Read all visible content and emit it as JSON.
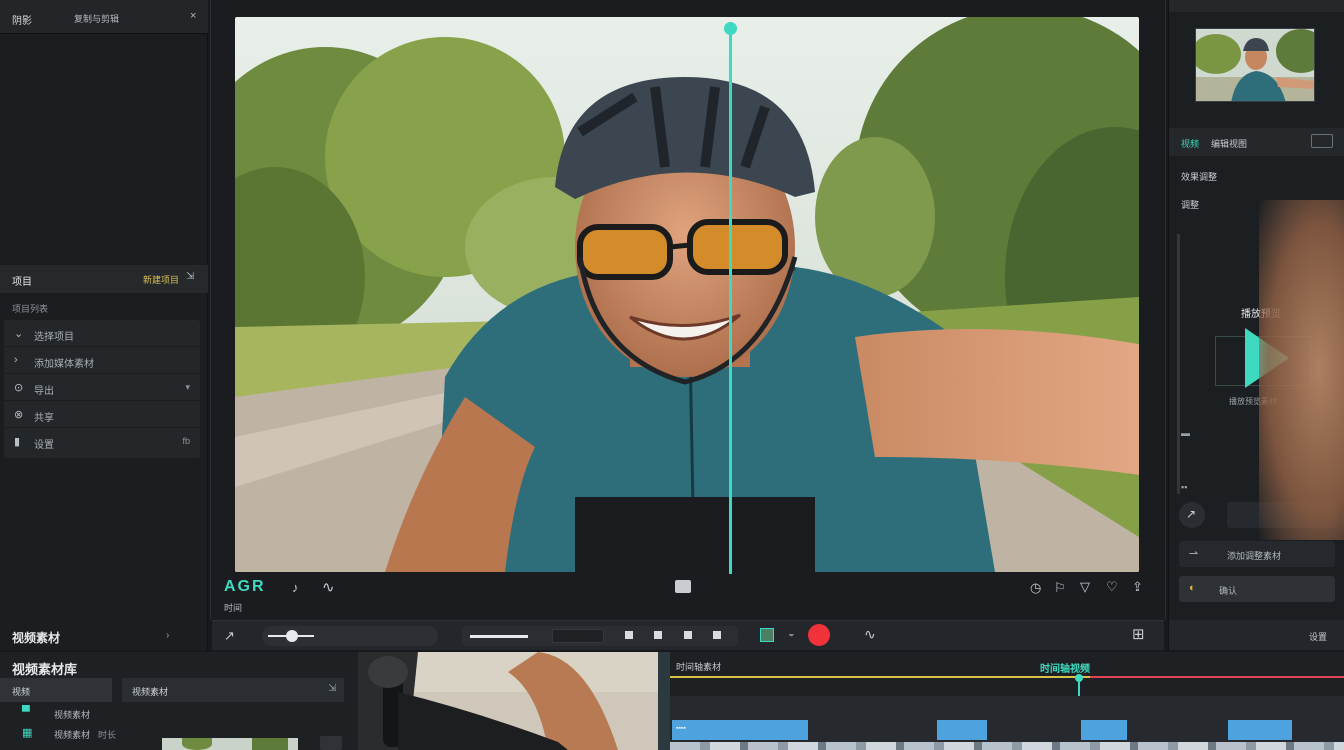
{
  "left": {
    "top_title": "阴影",
    "top_subtitle": "复制与剪辑",
    "section_title": "项目",
    "section_action": "新建项目",
    "subheader": "项目列表",
    "items": [
      {
        "icon": "⌄",
        "label": "选择项目",
        "end": ""
      },
      {
        "icon": "›",
        "label": "添加媒体素材",
        "end": ""
      },
      {
        "icon": "⊙",
        "label": "导出",
        "end": "▾"
      },
      {
        "icon": "⊗",
        "label": "共享",
        "end": ""
      },
      {
        "icon": "▮",
        "label": "设置",
        "end": "fb"
      }
    ],
    "footer_title": "视频素材",
    "footer_action": "›"
  },
  "viewer": {
    "timecode": "AGR",
    "timecode_label": "时间",
    "mode_icons": [
      "♪",
      "∿"
    ]
  },
  "right": {
    "header_tag": "视频",
    "header_title": "编辑视图",
    "label_one": "效果调整",
    "label_two": "调整",
    "play_label": "播放预览",
    "play_caption": "播放预览素材",
    "control_label": "添加调整素材",
    "button_label": "确认",
    "footer_label": "设置"
  },
  "bottom": {
    "title": "视频素材库",
    "tab_one": "视频",
    "tab_two": "视频素材",
    "row_one": "视频素材",
    "row_two": "视频素材",
    "row_two_end": "时长",
    "timeline_left_label": "时间轴素材",
    "timeline_center_label": "时间轴视频"
  },
  "colors": {
    "accent": "#3fd9c1",
    "record": "#f0323a",
    "clip_blue": "#4ea3de",
    "track_yellow": "#d8c34a"
  }
}
